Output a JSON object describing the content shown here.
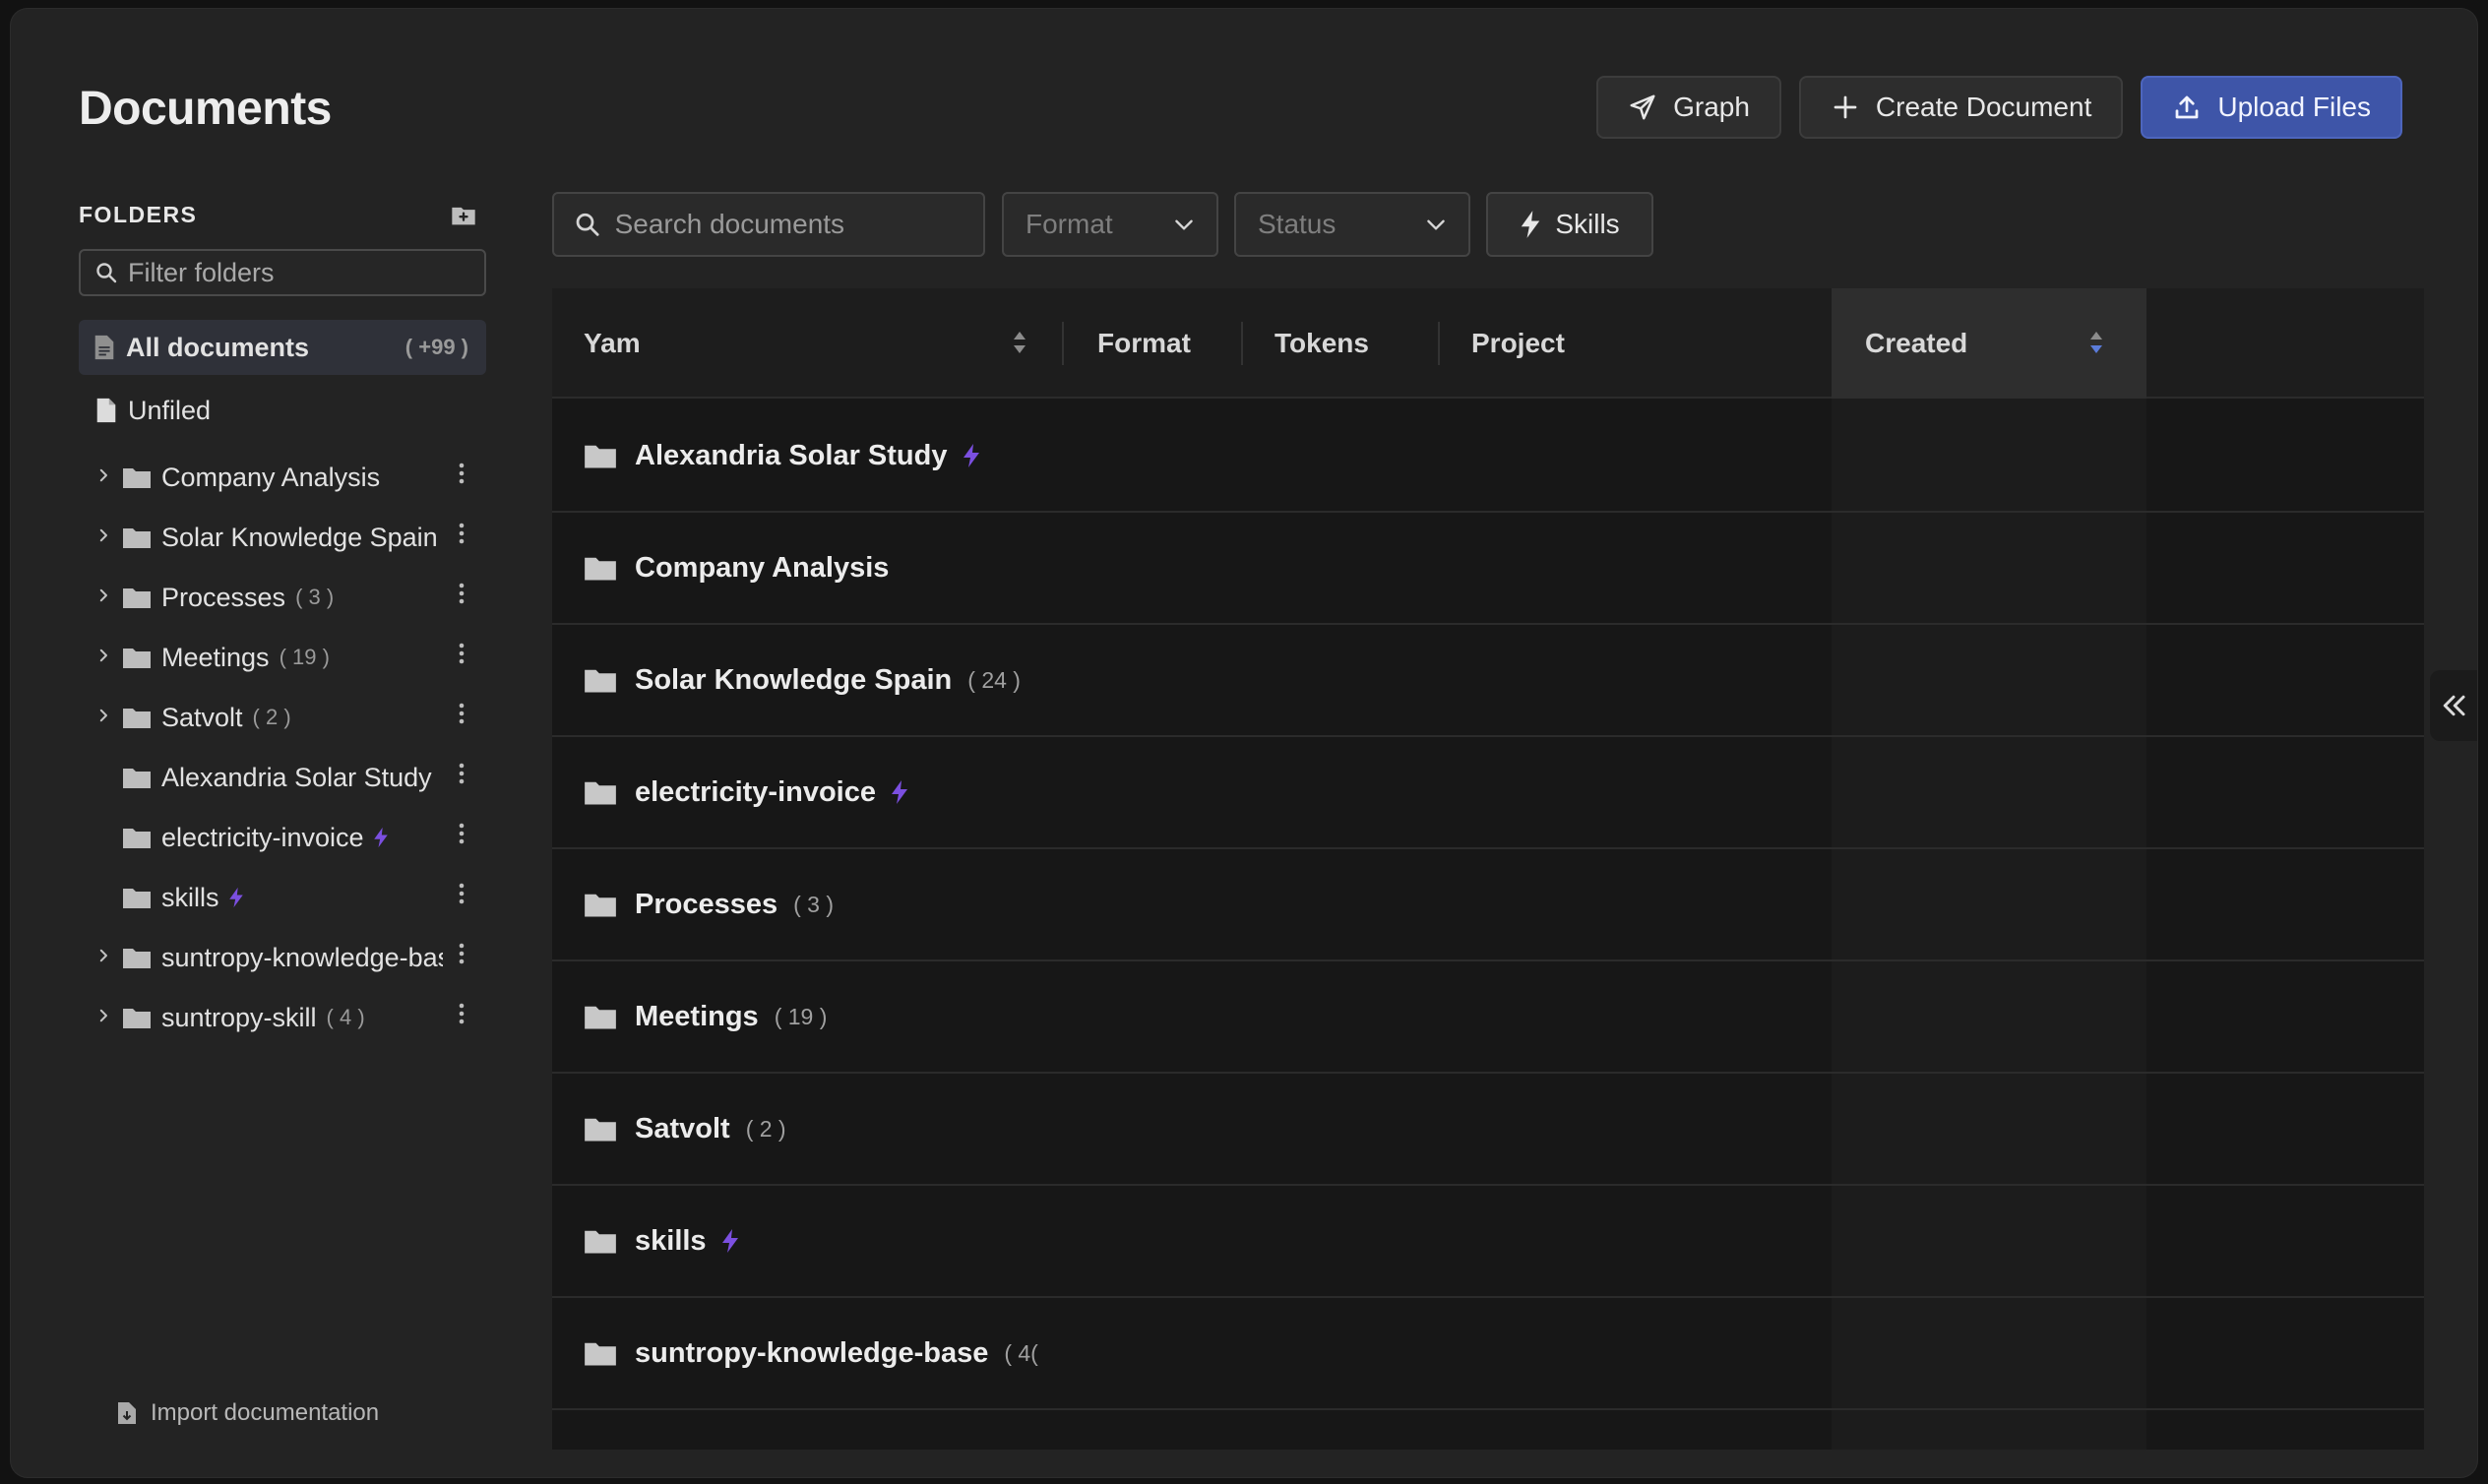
{
  "page": {
    "title": "Documents"
  },
  "actions": {
    "graph": "Graph",
    "create": "Create Document",
    "upload": "Upload Files"
  },
  "sidebar": {
    "heading": "FOLDERS",
    "filter_placeholder": "Filter folders",
    "all_documents": {
      "label": "All documents",
      "count": "( +99 )"
    },
    "unfiled": "Unfiled",
    "folders": [
      {
        "label": "Company Analysis",
        "count": "",
        "expandable": true,
        "bolt": false
      },
      {
        "label": "Solar Knowledge Spain",
        "count": "",
        "expandable": true,
        "bolt": false
      },
      {
        "label": "Processes",
        "count": "( 3 )",
        "expandable": true,
        "bolt": false
      },
      {
        "label": "Meetings",
        "count": "( 19 )",
        "expandable": true,
        "bolt": false
      },
      {
        "label": "Satvolt",
        "count": "( 2 )",
        "expandable": true,
        "bolt": false
      },
      {
        "label": "Alexandria Solar Study",
        "count": "",
        "expandable": false,
        "bolt": false
      },
      {
        "label": "electricity-invoice",
        "count": "",
        "expandable": false,
        "bolt": true
      },
      {
        "label": "skills",
        "count": "",
        "expandable": false,
        "bolt": true
      },
      {
        "label": "suntropy-knowledge-base",
        "count": "",
        "expandable": true,
        "bolt": false
      },
      {
        "label": "suntropy-skill",
        "count": "( 4 )",
        "expandable": true,
        "bolt": false
      }
    ],
    "import_label": "Import documentation"
  },
  "toolbar": {
    "search_placeholder": "Search documents",
    "format_placeholder": "Format",
    "status_placeholder": "Status",
    "skills_label": "Skills"
  },
  "table": {
    "columns": [
      "Yam",
      "Format",
      "Tokens",
      "Project",
      "Created"
    ],
    "rows": [
      {
        "name": "Alexandria Solar Study",
        "count": "",
        "bolt": true
      },
      {
        "name": "Company Analysis",
        "count": "",
        "bolt": false
      },
      {
        "name": "Solar Knowledge Spain",
        "count": "( 24 )",
        "bolt": false
      },
      {
        "name": "electricity-invoice",
        "count": "",
        "bolt": true
      },
      {
        "name": "Processes",
        "count": "( 3 )",
        "bolt": false
      },
      {
        "name": "Meetings",
        "count": "( 19 )",
        "bolt": false
      },
      {
        "name": "Satvolt",
        "count": "( 2 )",
        "bolt": false
      },
      {
        "name": "skills",
        "count": "",
        "bolt": true
      },
      {
        "name": "suntropy-knowledge-base",
        "count": "( 4(",
        "bolt": false
      }
    ]
  },
  "colors": {
    "accent": "#3e55a8",
    "bolt": "#7b4fe0",
    "sort_active": "#5b7cd9"
  }
}
